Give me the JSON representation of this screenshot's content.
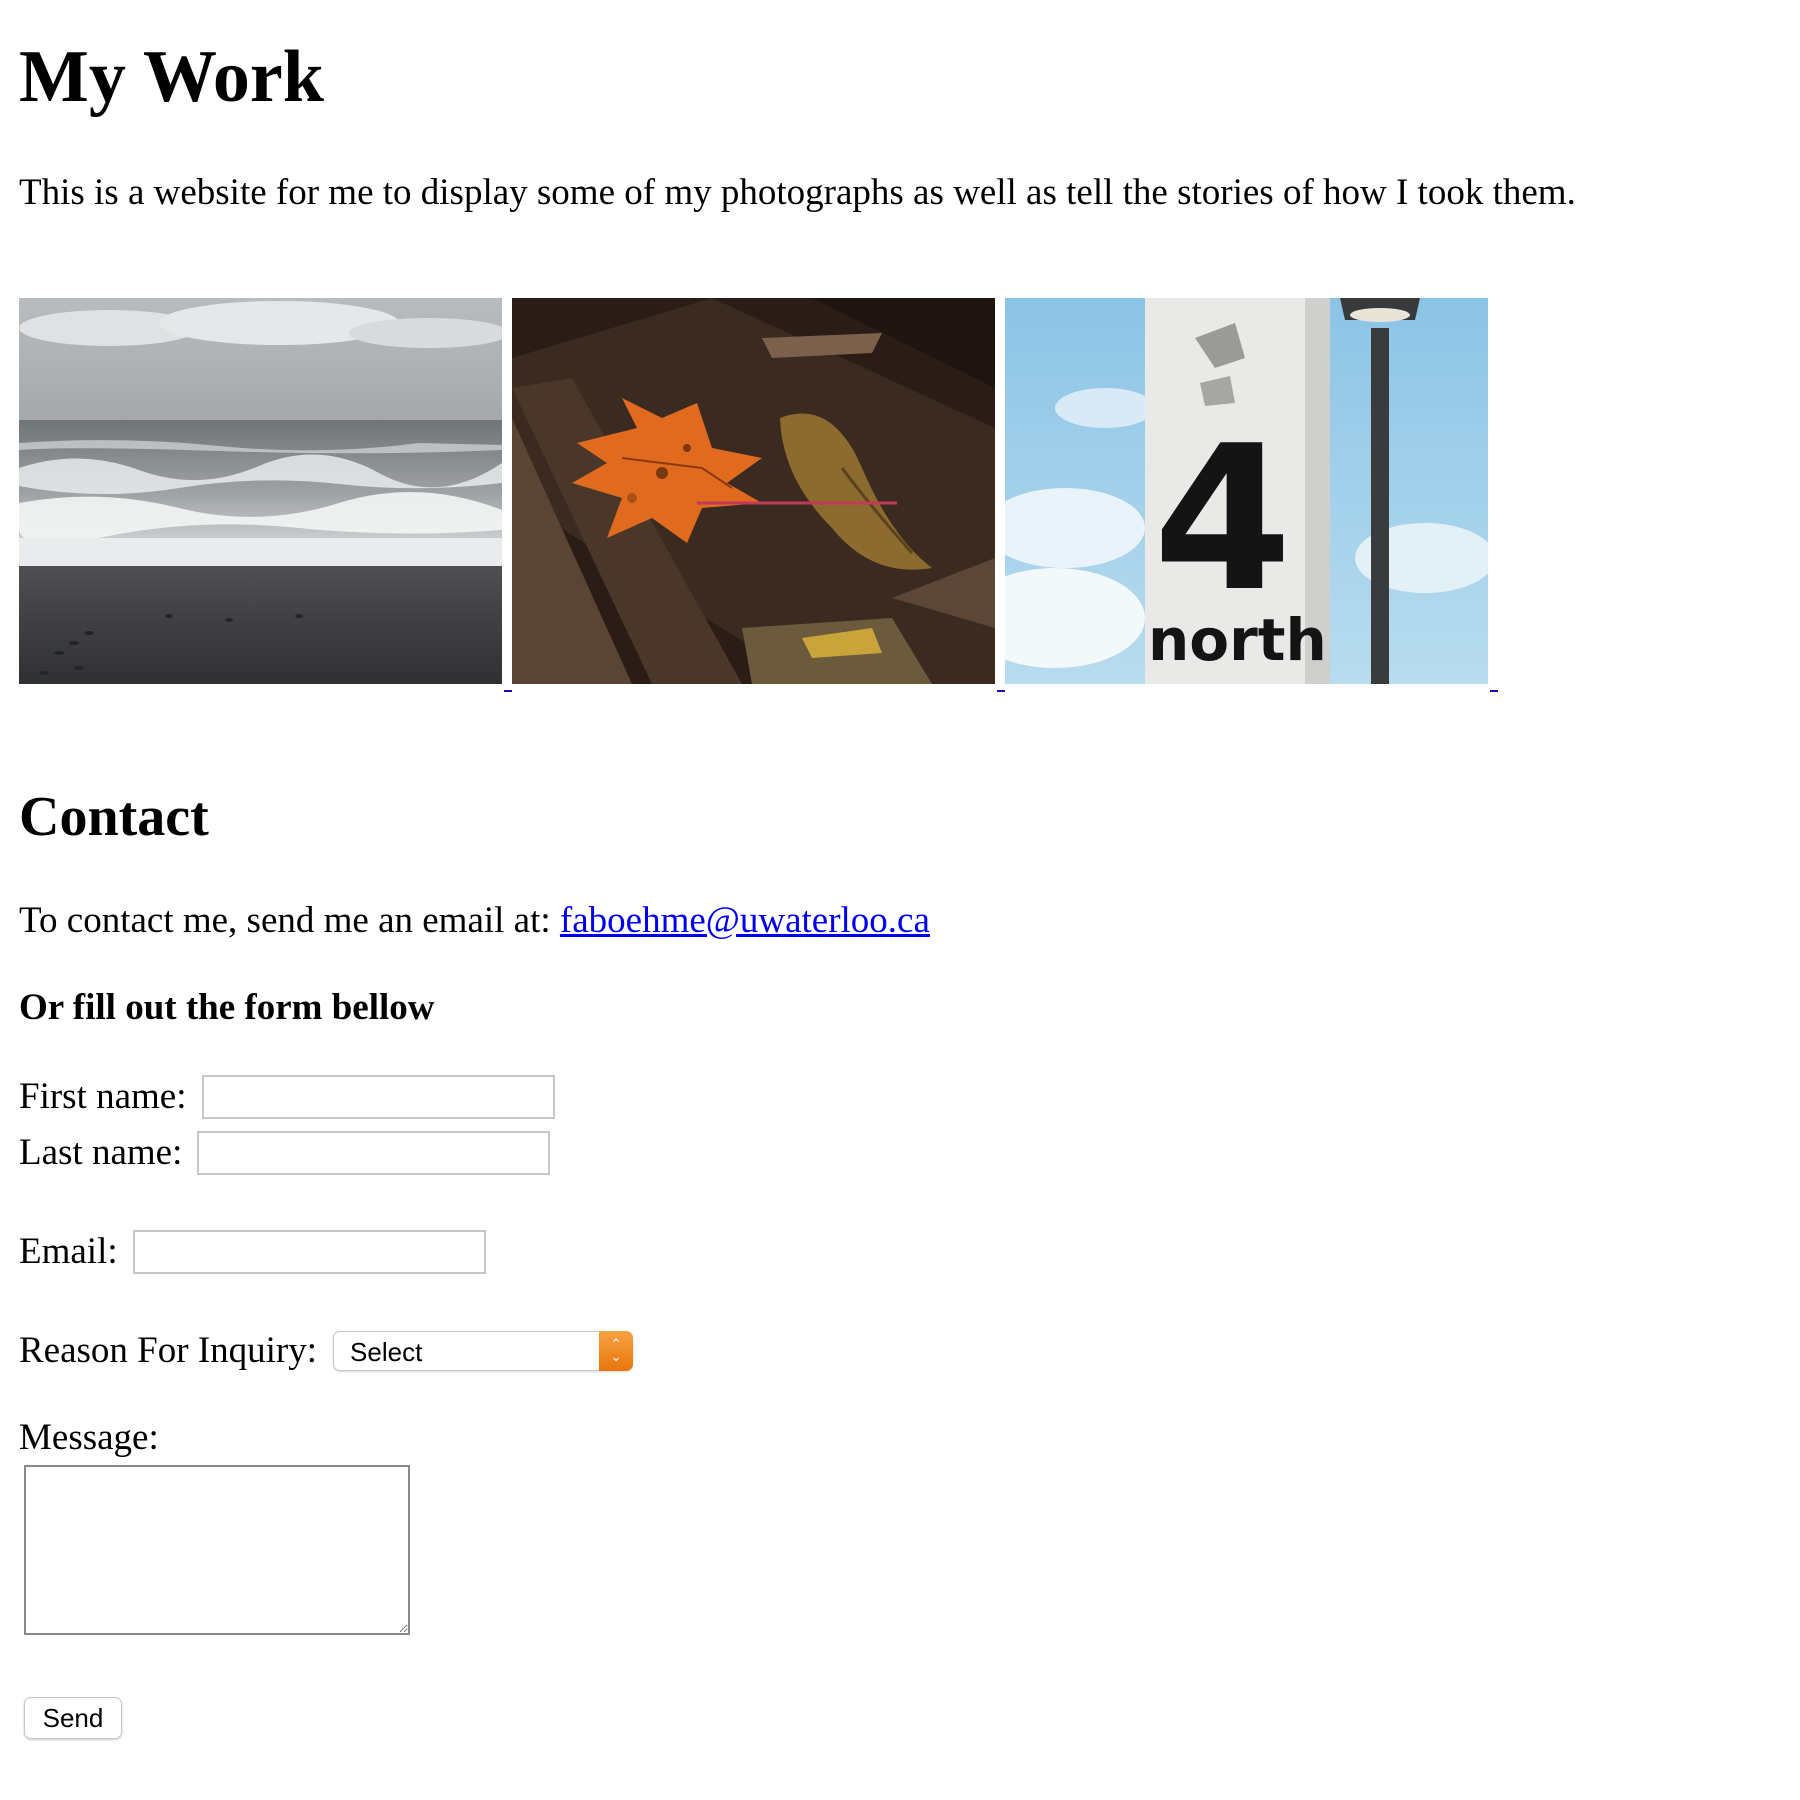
{
  "header": {
    "title": "My Work",
    "intro": "This is a website for me to display some of my photographs as well as tell the stories of how I took them."
  },
  "gallery": {
    "photos": [
      {
        "subject": "Stormy ocean waves on a black sand beach with footprints",
        "icon": "ocean-photo"
      },
      {
        "subject": "Orange autumn maple leaf lying on dark tree bark",
        "icon": "leaf-photo"
      },
      {
        "subject": "Concrete pillar with a large number sign and a street lamp against a blue sky",
        "icon": "sign-photo",
        "sign_number": "4",
        "sign_word": "north"
      }
    ]
  },
  "contact": {
    "heading": "Contact",
    "line_prefix": "To contact me, send me an email at: ",
    "email": "faboehme@uwaterloo.ca",
    "form_heading": "Or fill out the form bellow"
  },
  "form": {
    "first_name_label": "First name:",
    "first_name_value": "",
    "last_name_label": "Last name:",
    "last_name_value": "",
    "email_label": "Email:",
    "email_value": "",
    "reason_label": "Reason For Inquiry:",
    "reason_selected": "Select",
    "message_label": "Message:",
    "message_value": "",
    "send_label": "Send"
  },
  "colors": {
    "link": "#0000ee",
    "select_accent": "#f08a1c"
  }
}
